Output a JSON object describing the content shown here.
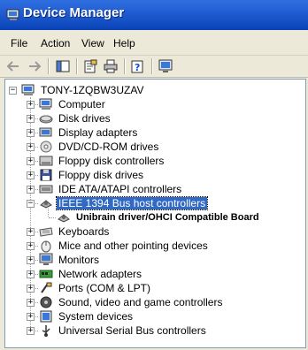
{
  "window": {
    "title": "Device Manager",
    "icon": "device-manager-icon"
  },
  "menu": [
    "File",
    "Action",
    "View",
    "Help"
  ],
  "toolbar": [
    "back-arrow-icon",
    "forward-arrow-icon",
    "show-hide-console-tree-icon",
    "properties-icon",
    "print-icon",
    "help-icon",
    "scan-hardware-icon"
  ],
  "tree": {
    "root": {
      "label": "TONY-1ZQBW3UZAV",
      "icon": "computer-icon",
      "expanded": true
    },
    "items": [
      {
        "label": "Computer",
        "icon": "computer-icon",
        "expanded": false
      },
      {
        "label": "Disk drives",
        "icon": "disk-drive-icon",
        "expanded": false
      },
      {
        "label": "Display adapters",
        "icon": "display-adapter-icon",
        "expanded": false
      },
      {
        "label": "DVD/CD-ROM drives",
        "icon": "cd-drive-icon",
        "expanded": false
      },
      {
        "label": "Floppy disk controllers",
        "icon": "floppy-controller-icon",
        "expanded": false
      },
      {
        "label": "Floppy disk drives",
        "icon": "floppy-drive-icon",
        "expanded": false
      },
      {
        "label": "IDE ATA/ATAPI controllers",
        "icon": "ide-controller-icon",
        "expanded": false
      },
      {
        "label": "IEEE 1394 Bus host controllers",
        "icon": "ieee1394-icon",
        "expanded": true,
        "selected": true,
        "children": [
          {
            "label": "Unibrain driver/OHCI Compatible Board",
            "icon": "ieee1394-device-icon"
          }
        ]
      },
      {
        "label": "Keyboards",
        "icon": "keyboard-icon",
        "expanded": false
      },
      {
        "label": "Mice and other pointing devices",
        "icon": "mouse-icon",
        "expanded": false
      },
      {
        "label": "Monitors",
        "icon": "monitor-icon",
        "expanded": false
      },
      {
        "label": "Network adapters",
        "icon": "network-adapter-icon",
        "expanded": false
      },
      {
        "label": "Ports (COM & LPT)",
        "icon": "port-icon",
        "expanded": false
      },
      {
        "label": "Sound, video and game controllers",
        "icon": "sound-icon",
        "expanded": false
      },
      {
        "label": "System devices",
        "icon": "system-devices-icon",
        "expanded": false
      },
      {
        "label": "Universal Serial Bus controllers",
        "icon": "usb-icon",
        "expanded": false
      }
    ]
  },
  "colors": {
    "title_bar": "#0a43b8",
    "selection": "#316ac5",
    "window_bg": "#ece9d8"
  }
}
